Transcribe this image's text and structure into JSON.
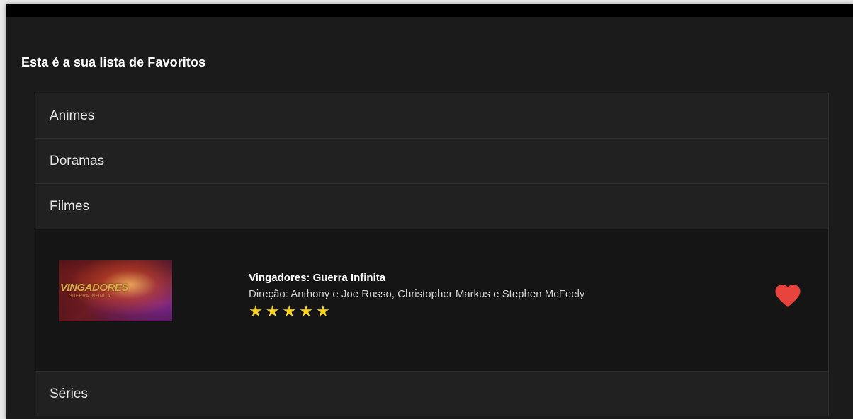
{
  "page": {
    "heading": "Esta é a sua lista de Favoritos"
  },
  "accordion": {
    "sections": [
      {
        "label": "Animes",
        "expanded": false
      },
      {
        "label": "Doramas",
        "expanded": false
      },
      {
        "label": "Filmes",
        "expanded": true
      },
      {
        "label": "Séries",
        "expanded": false
      }
    ]
  },
  "filmes": {
    "items": [
      {
        "poster_title": "VINGADORES",
        "poster_subtitle": "GUERRA INFINITA",
        "title": "Vingadores: Guerra Infinita",
        "director": "Direção: Anthony e Joe Russo, Christopher Markus e Stephen McFeely",
        "rating": 5,
        "rating_max": 5,
        "favorite": true,
        "favorite_icon": "heart-icon"
      }
    ]
  },
  "colors": {
    "background": "#1b1b1b",
    "header_bg": "#212121",
    "body_bg": "#151515",
    "star": "#f7d21c",
    "heart": "#e8433d"
  }
}
